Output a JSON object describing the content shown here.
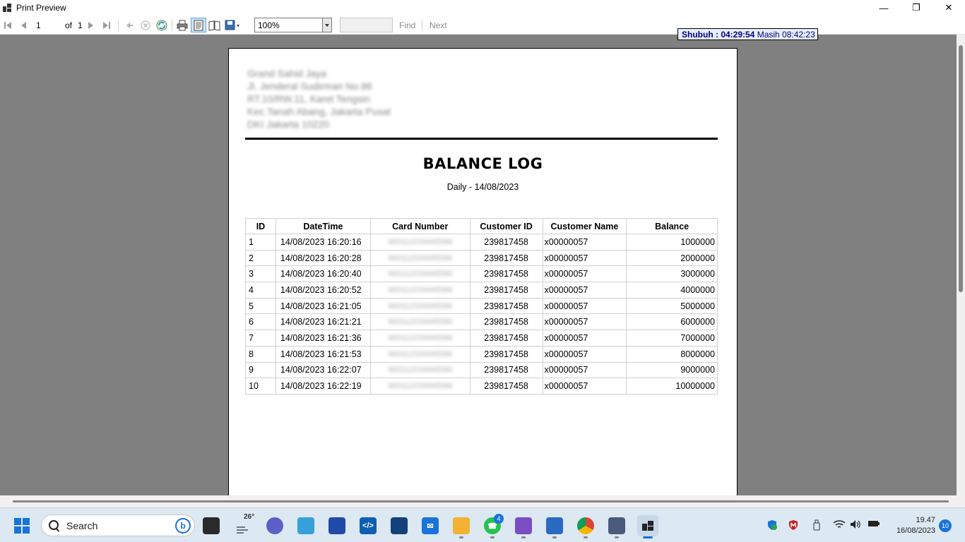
{
  "window": {
    "title": "Print Preview"
  },
  "toolbar": {
    "page_current": "1",
    "page_of_label": "of",
    "page_total": "1",
    "zoom_value": "100%",
    "find_label": "Find",
    "next_label": "Next"
  },
  "prayer_clock": {
    "name_time": "Shubuh : 04:29:54",
    "remaining": "Masih 08:42:23"
  },
  "report": {
    "company_lines": [
      "Grand Sahid Jaya",
      "Jl. Jenderal Sudirman No.86",
      "RT.10/RW.11, Karet Tengsin",
      "Kec.Tanah Abang, Jakarta Pusat",
      "DKI Jakarta 10220"
    ],
    "title": "BALANCE LOG",
    "subtitle": "Daily - 14/08/2023",
    "columns": {
      "id": "ID",
      "datetime": "DateTime",
      "card": "Card Number",
      "customer_id": "Customer ID",
      "customer_name": "Customer Name",
      "balance": "Balance"
    },
    "rows": [
      {
        "id": "1",
        "datetime": "14/08/2023 16:20:16",
        "card": "900112233445566",
        "customer_id": "239817458",
        "customer_name": "x00000057",
        "balance": "1000000"
      },
      {
        "id": "2",
        "datetime": "14/08/2023 16:20:28",
        "card": "900112233445566",
        "customer_id": "239817458",
        "customer_name": "x00000057",
        "balance": "2000000"
      },
      {
        "id": "3",
        "datetime": "14/08/2023 16:20:40",
        "card": "900112233445566",
        "customer_id": "239817458",
        "customer_name": "x00000057",
        "balance": "3000000"
      },
      {
        "id": "4",
        "datetime": "14/08/2023 16:20:52",
        "card": "900112233445566",
        "customer_id": "239817458",
        "customer_name": "x00000057",
        "balance": "4000000"
      },
      {
        "id": "5",
        "datetime": "14/08/2023 16:21:05",
        "card": "900112233445566",
        "customer_id": "239817458",
        "customer_name": "x00000057",
        "balance": "5000000"
      },
      {
        "id": "6",
        "datetime": "14/08/2023 16:21:21",
        "card": "900112233445566",
        "customer_id": "239817458",
        "customer_name": "x00000057",
        "balance": "6000000"
      },
      {
        "id": "7",
        "datetime": "14/08/2023 16:21:36",
        "card": "900112233445566",
        "customer_id": "239817458",
        "customer_name": "x00000057",
        "balance": "7000000"
      },
      {
        "id": "8",
        "datetime": "14/08/2023 16:21:53",
        "card": "900112233445566",
        "customer_id": "239817458",
        "customer_name": "x00000057",
        "balance": "8000000"
      },
      {
        "id": "9",
        "datetime": "14/08/2023 16:22:07",
        "card": "900112233445566",
        "customer_id": "239817458",
        "customer_name": "x00000057",
        "balance": "9000000"
      },
      {
        "id": "10",
        "datetime": "14/08/2023 16:22:19",
        "card": "900112233445566",
        "customer_id": "239817458",
        "customer_name": "x00000057",
        "balance": "10000000"
      }
    ]
  },
  "taskbar": {
    "search_placeholder": "Search",
    "weather_temp": "26°",
    "whatsapp_badge": "4",
    "clock_time": "19.47",
    "clock_date": "16/08/2023",
    "notification_count": "10"
  }
}
